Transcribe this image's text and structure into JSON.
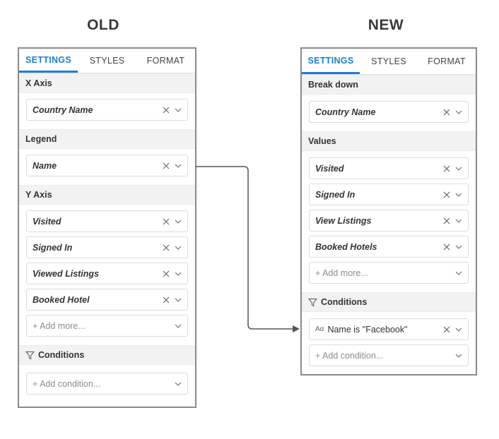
{
  "headings": {
    "old": "OLD",
    "new": "NEW"
  },
  "tabs": [
    "SETTINGS",
    "STYLES",
    "FORMAT"
  ],
  "old_panel": {
    "sections": {
      "x_axis": "X Axis",
      "legend": "Legend",
      "y_axis": "Y Axis",
      "conditions": "Conditions"
    },
    "x_axis_field": "Country Name",
    "legend_field": "Name",
    "y_axis_fields": [
      "Visited",
      "Signed In",
      "Viewed Listings",
      "Booked Hotel"
    ],
    "add_more": "+ Add more...",
    "add_condition": "+ Add condition..."
  },
  "new_panel": {
    "sections": {
      "break_down": "Break down",
      "values": "Values",
      "conditions": "Conditions"
    },
    "break_down_field": "Country Name",
    "value_fields": [
      "Visited",
      "Signed In",
      "View Listings",
      "Booked Hotels"
    ],
    "add_more": "+ Add more...",
    "condition_type_icon": "Aα",
    "condition": "Name is \"Facebook\"",
    "add_condition": "+ Add condition..."
  },
  "colors": {
    "accent": "#1c7ed6",
    "border": "#8a8a8a",
    "arrow": "#555555"
  }
}
